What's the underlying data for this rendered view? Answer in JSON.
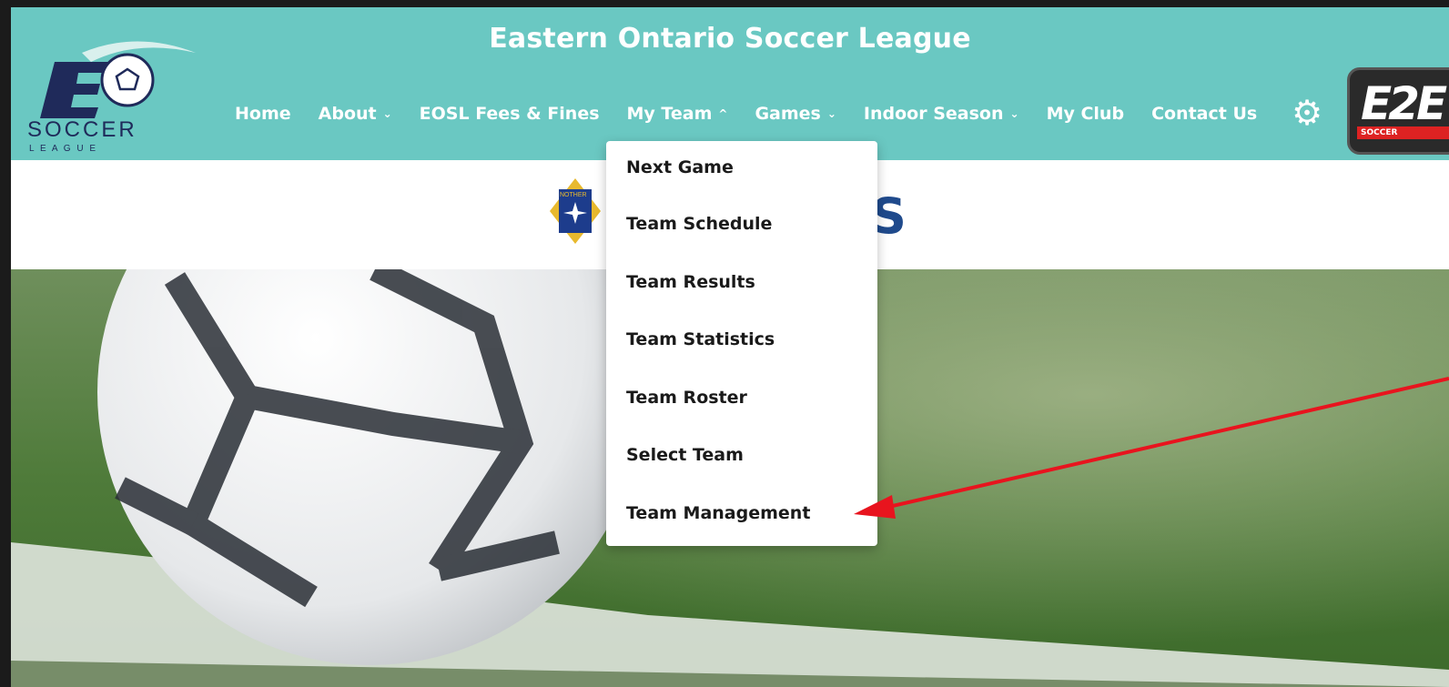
{
  "header": {
    "title": "Eastern Ontario Soccer League",
    "logo": {
      "line1": "SOCCER",
      "line2": "L E A G U E"
    },
    "nav": [
      {
        "label": "Home",
        "has_chevron": false
      },
      {
        "label": "About",
        "has_chevron": true,
        "chevron": "⌄"
      },
      {
        "label": "EOSL Fees & Fines",
        "has_chevron": false
      },
      {
        "label": "My Team",
        "has_chevron": true,
        "chevron": "^"
      },
      {
        "label": "Games",
        "has_chevron": true,
        "chevron": "⌄"
      },
      {
        "label": "Indoor Season",
        "has_chevron": true,
        "chevron": "⌄"
      },
      {
        "label": "My Club",
        "has_chevron": false
      },
      {
        "label": "Contact Us",
        "has_chevron": false
      }
    ],
    "settings_icon": "gear-icon",
    "badge": {
      "text": "E2E",
      "subtext": "SOCCER"
    }
  },
  "partner": {
    "logo_text": "NOTHER",
    "text": "S"
  },
  "dropdown": {
    "items": [
      "Next Game",
      "Team Schedule",
      "Team Results",
      "Team Statistics",
      "Team Roster",
      "Select Team",
      "Team Management"
    ]
  },
  "colors": {
    "header_bg": "#6ac8c2",
    "nav_text": "#ffffff",
    "arrow": "#e8141e"
  }
}
